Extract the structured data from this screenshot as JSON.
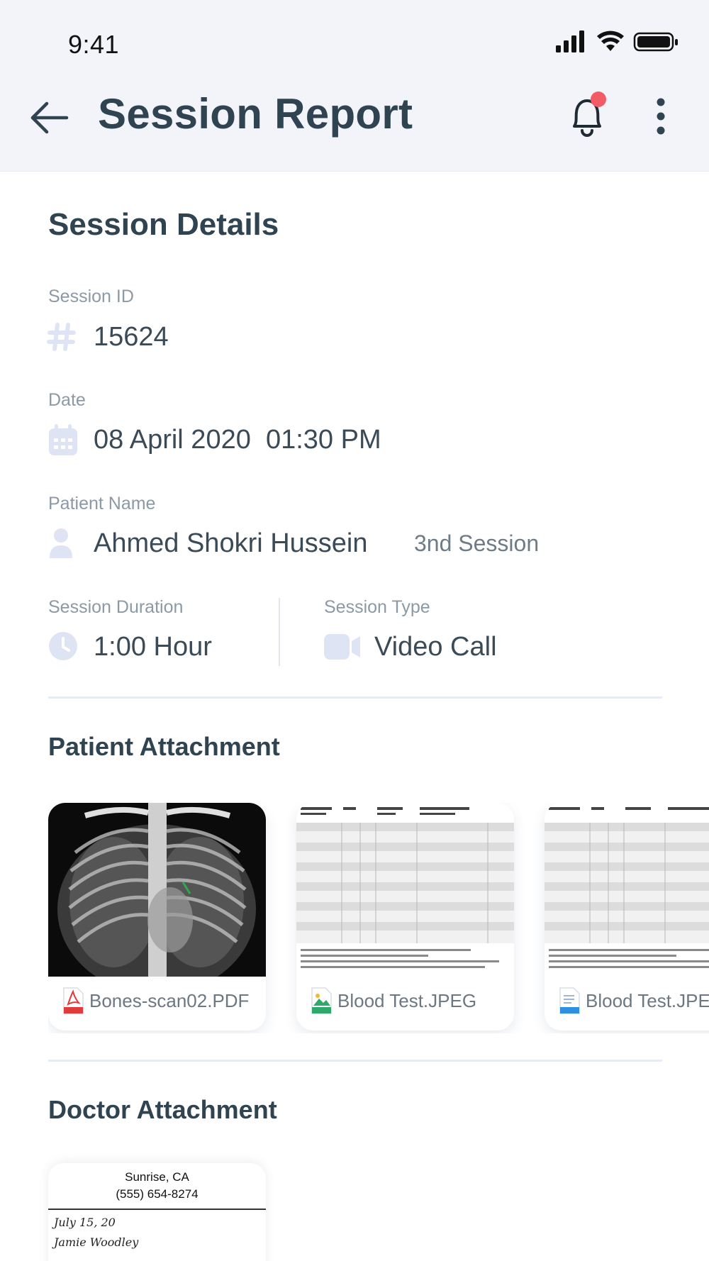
{
  "status_bar": {
    "time": "9:41"
  },
  "app_bar": {
    "title": "Session Report"
  },
  "session_details": {
    "heading": "Session Details",
    "session_id": {
      "label": "Session ID",
      "value": "15624"
    },
    "date": {
      "label": "Date",
      "value": "08 April 2020  01:30 PM"
    },
    "patient": {
      "label": "Patient Name",
      "value": "Ahmed Shokri Hussein",
      "session_badge": "3nd Session"
    },
    "duration": {
      "label": "Session Duration",
      "value": "1:00 Hour"
    },
    "type": {
      "label": "Session Type",
      "value": "Video Call"
    }
  },
  "patient_attachment": {
    "heading": "Patient Attachment",
    "files": [
      {
        "name": "Bones-scan02.PDF",
        "icon": "pdf-file-icon"
      },
      {
        "name": "Blood Test.JPEG",
        "icon": "image-file-icon"
      },
      {
        "name": "Blood Test.JPEG",
        "icon": "doc-file-icon"
      }
    ]
  },
  "doctor_attachment": {
    "heading": "Doctor Attachment",
    "document": {
      "line1": "Sunrise, CA",
      "line2": "(555) 654-8274",
      "hand1": "July 15, 20",
      "hand2": "Jamie Woodley"
    }
  },
  "colors": {
    "header_bg": "#f2f4f9",
    "title": "#2f4351",
    "label": "#8c99a6",
    "icon_tint": "#dfe4f5",
    "notification_dot": "#f25c66"
  }
}
